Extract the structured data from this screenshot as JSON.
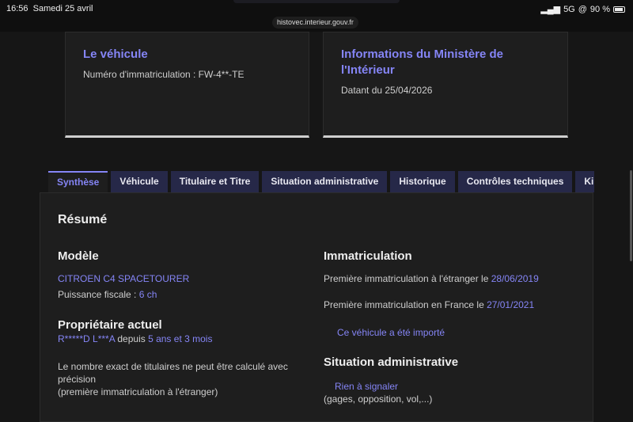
{
  "status": {
    "time": "16:56",
    "date": "Samedi 25 avril",
    "network": "5G",
    "battery": "90 %",
    "url": "histovec.interieur.gouv.fr"
  },
  "cards": [
    {
      "title": "Le véhicule",
      "text": "Numéro d'immatriculation : FW-4**-TE"
    },
    {
      "title": "Informations du Ministère de l'Intérieur",
      "text": "Datant du 25/04/2026"
    }
  ],
  "tabs": [
    "Synthèse",
    "Véhicule",
    "Titulaire et Titre",
    "Situation administrative",
    "Historique",
    "Contrôles techniques",
    "Kilométrage"
  ],
  "summary": {
    "title": "Résumé",
    "model_heading": "Modèle",
    "model": "CITROEN C4 SPACETOURER",
    "power_label": "Puissance fiscale : ",
    "power": "6 ch",
    "owner_heading": "Propriétaire actuel",
    "owner": "R*****D L***A",
    "since_label": " depuis ",
    "since": "5 ans et 3 mois",
    "owner_note": "Le nombre exact de titulaires ne peut être calculé avec précision",
    "owner_note2": "(première immatriculation à l'étranger)",
    "immat_heading": "Immatriculation",
    "first_foreign_label": "Première immatriculation à l'étranger le ",
    "first_foreign": "28/06/2019",
    "first_fr_label": "Première immatriculation en France le ",
    "first_fr": "27/01/2021",
    "imported": "Ce véhicule a été importé",
    "admin_heading": "Situation administrative",
    "admin_status": "Rien à signaler",
    "admin_note": "(gages, opposition, vol,...)"
  }
}
